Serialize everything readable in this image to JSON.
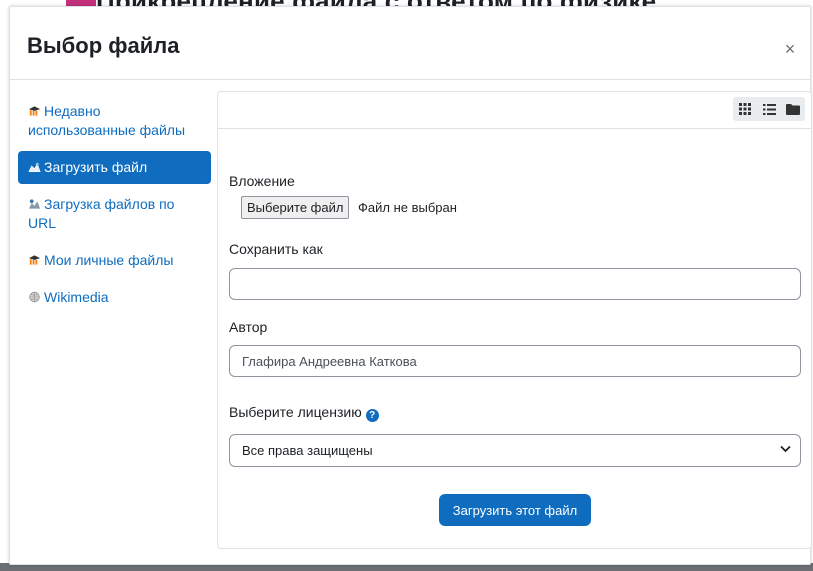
{
  "background": {
    "heading": "Прикрепление файла с ответом по физике"
  },
  "dialog": {
    "title": "Выбор файла",
    "close_glyph": "×"
  },
  "sidebar": {
    "items": [
      {
        "label": "Недавно использованные файлы",
        "icon": "moodle-hat-icon",
        "active": false
      },
      {
        "label": "Загрузить файл",
        "icon": "upload-cloud-icon",
        "active": true
      },
      {
        "label": "Загрузка файлов по URL",
        "icon": "url-download-icon",
        "active": false
      },
      {
        "label": "Мои личные файлы",
        "icon": "moodle-hat-icon",
        "active": false
      },
      {
        "label": "Wikimedia",
        "icon": "wikimedia-globe-icon",
        "active": false
      }
    ]
  },
  "view_toggle": {
    "icons": [
      "grid-view-icon",
      "list-view-icon",
      "folder-view-icon"
    ]
  },
  "form": {
    "attachment_label": "Вложение",
    "choose_file_button": "Выберите файл",
    "no_file_text": "Файл не выбран",
    "save_as_label": "Сохранить как",
    "save_as_value": "",
    "author_label": "Автор",
    "author_value": "Глафира Андреевна Каткова",
    "license_label": "Выберите лицензию",
    "license_selected": "Все права защищены",
    "upload_button": "Загрузить этот файл"
  },
  "colors": {
    "accent": "#0f6cbf",
    "moodle_orange": "#f98012",
    "text": "#1d2125",
    "border": "#dee2e6"
  }
}
